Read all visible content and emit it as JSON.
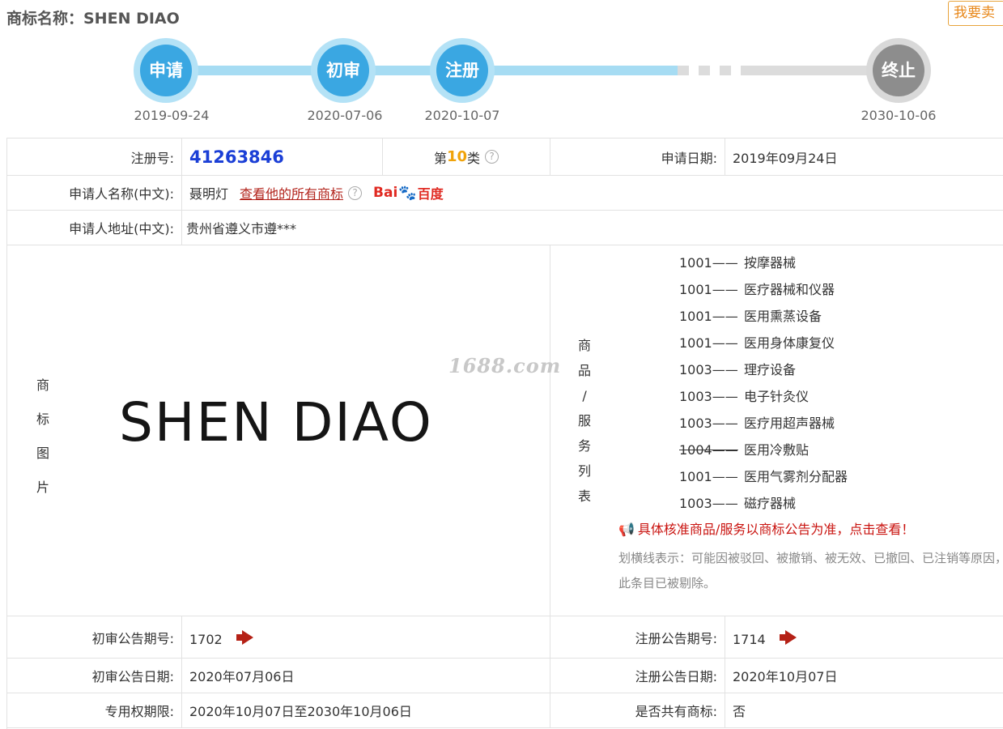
{
  "header": {
    "title": "商标名称：SHEN DIAO",
    "sell_button": "我要卖"
  },
  "progress": {
    "steps": [
      {
        "label": "申请",
        "date": "2019-09-24",
        "status": "done"
      },
      {
        "label": "初审",
        "date": "2020-07-06",
        "status": "done"
      },
      {
        "label": "注册",
        "date": "2020-10-07",
        "status": "done"
      },
      {
        "label": "终止",
        "date": "2030-10-06",
        "status": "future"
      }
    ]
  },
  "details": {
    "reg_no_label": "注册号:",
    "reg_no": "41263846",
    "class_prefix": "第",
    "class_num": "10",
    "class_suffix": "类",
    "apply_date_label": "申请日期:",
    "apply_date": "2019年09月24日",
    "applicant_label": "申请人名称(中文):",
    "applicant": "聂明灯",
    "applicant_link": "查看他的所有商标",
    "baidu_bai": "Bai",
    "baidu_du": "百度",
    "address_label": "申请人地址(中文):",
    "address": "贵州省遵义市遵***",
    "image_label": [
      "商",
      "标",
      "图",
      "片"
    ],
    "logo_text": "SHEN DIAO",
    "watermark": "1688.com",
    "goods_label": [
      "商",
      "品",
      "/",
      "服",
      "务",
      "列",
      "表"
    ],
    "goods": [
      {
        "code": "1001——",
        "name": "按摩器械",
        "struck": false
      },
      {
        "code": "1001——",
        "name": "医疗器械和仪器",
        "struck": false
      },
      {
        "code": "1001——",
        "name": "医用熏蒸设备",
        "struck": false
      },
      {
        "code": "1001——",
        "name": "医用身体康复仪",
        "struck": false
      },
      {
        "code": "1003——",
        "name": "理疗设备",
        "struck": false
      },
      {
        "code": "1003——",
        "name": "电子针灸仪",
        "struck": false
      },
      {
        "code": "1003——",
        "name": "医疗用超声器械",
        "struck": false
      },
      {
        "code": "1004——",
        "name": "医用冷敷贴",
        "struck": true
      },
      {
        "code": "1001——",
        "name": "医用气雾剂分配器",
        "struck": false
      },
      {
        "code": "1003——",
        "name": "磁疗器械",
        "struck": false
      }
    ],
    "notice": "具体核准商品/服务以商标公告为准，点击查看！",
    "strike_note": "划横线表示：可能因被驳回、被撤销、被无效、已撤回、已注销等原因，此条目已被剔除。",
    "prelim_no_label": "初审公告期号:",
    "prelim_no": "1702",
    "reg_notice_no_label": "注册公告期号:",
    "reg_notice_no": "1714",
    "prelim_date_label": "初审公告日期:",
    "prelim_date": "2020年07月06日",
    "reg_notice_date_label": "注册公告日期:",
    "reg_notice_date": "2020年10月07日",
    "term_label": "专用权期限:",
    "term": "2020年10月07日至2030年10月06日",
    "shared_label": "是否共有商标:",
    "shared": "否"
  }
}
